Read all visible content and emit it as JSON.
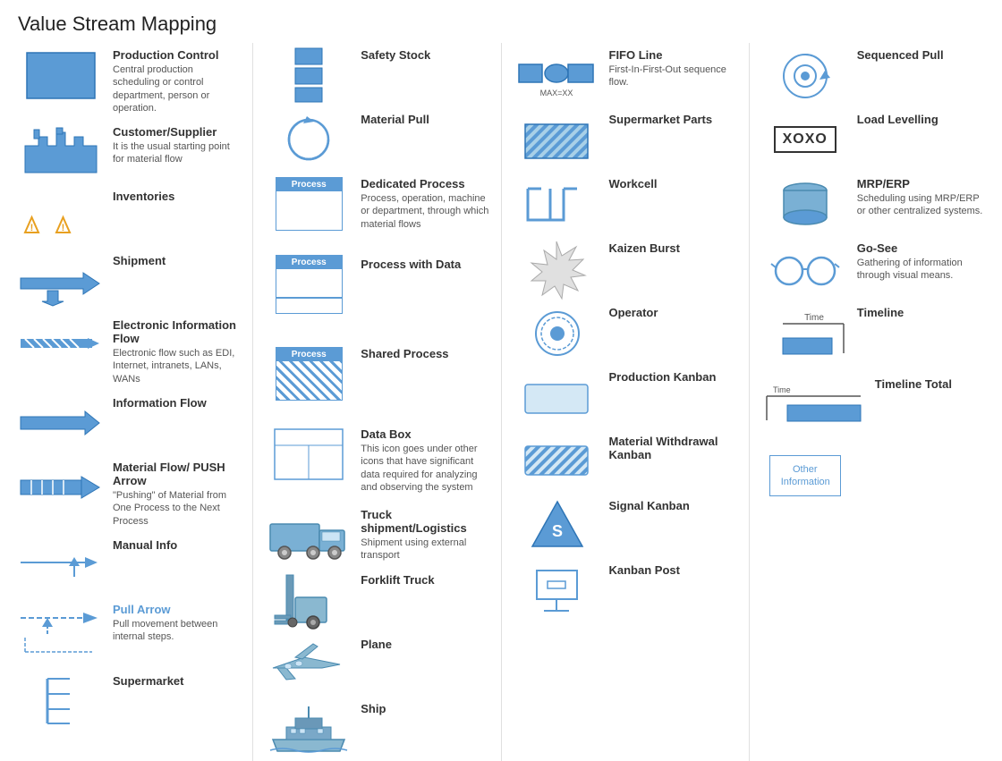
{
  "title": "Value Stream Mapping",
  "columns": [
    {
      "id": "col1",
      "items": [
        {
          "id": "production-control",
          "name": "Production Control",
          "desc": "Central production scheduling or control department, person or operation.",
          "icon": "production-control"
        },
        {
          "id": "customer-supplier",
          "name": "Customer/Supplier",
          "desc": "It is the usual starting point for material flow",
          "icon": "customer-supplier"
        },
        {
          "id": "inventories",
          "name": "Inventories",
          "desc": "",
          "icon": "inventories"
        },
        {
          "id": "shipment",
          "name": "Shipment",
          "desc": "",
          "icon": "shipment"
        },
        {
          "id": "electronic-info-flow",
          "name": "Electronic Information Flow",
          "desc": "Electronic flow such as EDI, Internet, intranets, LANs, WANs",
          "icon": "electronic-info-flow"
        },
        {
          "id": "information-flow",
          "name": "Information Flow",
          "desc": "",
          "icon": "information-flow"
        },
        {
          "id": "material-flow-push",
          "name": "Material Flow/ PUSH Arrow",
          "desc": "\"Pushing\" of Material from One Process to the Next Process",
          "icon": "material-flow-push"
        },
        {
          "id": "manual-info",
          "name": "Manual Info",
          "desc": "",
          "icon": "manual-info"
        },
        {
          "id": "pull-arrow",
          "name": "Pull Arrow",
          "desc": "Pull movement between internal steps.",
          "icon": "pull-arrow"
        },
        {
          "id": "supermarket",
          "name": "Supermarket",
          "desc": "",
          "icon": "supermarket"
        }
      ]
    },
    {
      "id": "col2",
      "items": [
        {
          "id": "safety-stock",
          "name": "Safety Stock",
          "desc": "",
          "icon": "safety-stock"
        },
        {
          "id": "material-pull",
          "name": "Material Pull",
          "desc": "",
          "icon": "material-pull"
        },
        {
          "id": "dedicated-process",
          "name": "Dedicated Process",
          "desc": "Process, operation, machine or department, through which material flows",
          "icon": "dedicated-process"
        },
        {
          "id": "process-with-data",
          "name": "Process with Data",
          "desc": "",
          "icon": "process-with-data"
        },
        {
          "id": "shared-process",
          "name": "Shared Process",
          "desc": "",
          "icon": "shared-process"
        },
        {
          "id": "data-box",
          "name": "Data Box",
          "desc": "This icon goes under other icons that have significant data required for analyzing and observing the system",
          "icon": "data-box"
        },
        {
          "id": "truck-shipment",
          "name": "Truck shipment/Logistics",
          "desc": "Shipment using external transport",
          "icon": "truck-shipment"
        },
        {
          "id": "forklift",
          "name": "Forklift Truck",
          "desc": "",
          "icon": "forklift"
        },
        {
          "id": "plane",
          "name": "Plane",
          "desc": "",
          "icon": "plane"
        },
        {
          "id": "ship",
          "name": "Ship",
          "desc": "",
          "icon": "ship"
        }
      ]
    },
    {
      "id": "col3",
      "items": [
        {
          "id": "fifo-line",
          "name": "FIFO Line",
          "desc": "First-In-First-Out sequence flow.",
          "sub": "MAX=XX",
          "icon": "fifo-line"
        },
        {
          "id": "supermarket-parts",
          "name": "Supermarket Parts",
          "desc": "",
          "icon": "supermarket-parts"
        },
        {
          "id": "workcell",
          "name": "Workcell",
          "desc": "",
          "icon": "workcell"
        },
        {
          "id": "kaizen-burst",
          "name": "Kaizen Burst",
          "desc": "",
          "icon": "kaizen-burst"
        },
        {
          "id": "operator",
          "name": "Operator",
          "desc": "",
          "icon": "operator"
        },
        {
          "id": "production-kanban",
          "name": "Production Kanban",
          "desc": "",
          "icon": "production-kanban"
        },
        {
          "id": "material-withdrawal-kanban",
          "name": "Material Withdrawal Kanban",
          "desc": "",
          "icon": "material-withdrawal-kanban"
        },
        {
          "id": "signal-kanban",
          "name": "Signal Kanban",
          "desc": "",
          "icon": "signal-kanban"
        },
        {
          "id": "kanban-post",
          "name": "Kanban Post",
          "desc": "",
          "icon": "kanban-post"
        }
      ]
    },
    {
      "id": "col4",
      "items": [
        {
          "id": "sequenced-pull",
          "name": "Sequenced Pull",
          "desc": "",
          "icon": "sequenced-pull"
        },
        {
          "id": "load-levelling",
          "name": "Load Levelling",
          "desc": "",
          "icon": "load-levelling"
        },
        {
          "id": "mrp-erp",
          "name": "MRP/ERP",
          "desc": "Scheduling using MRP/ERP or other centralized systems.",
          "icon": "mrp-erp"
        },
        {
          "id": "go-see",
          "name": "Go-See",
          "desc": "Gathering of information through visual means.",
          "icon": "go-see"
        },
        {
          "id": "timeline",
          "name": "Timeline",
          "desc": "",
          "icon": "timeline"
        },
        {
          "id": "timeline-total",
          "name": "Timeline Total",
          "desc": "",
          "icon": "timeline-total"
        },
        {
          "id": "other-information",
          "name": "Other Information",
          "desc": "",
          "icon": "other-information"
        }
      ]
    }
  ]
}
